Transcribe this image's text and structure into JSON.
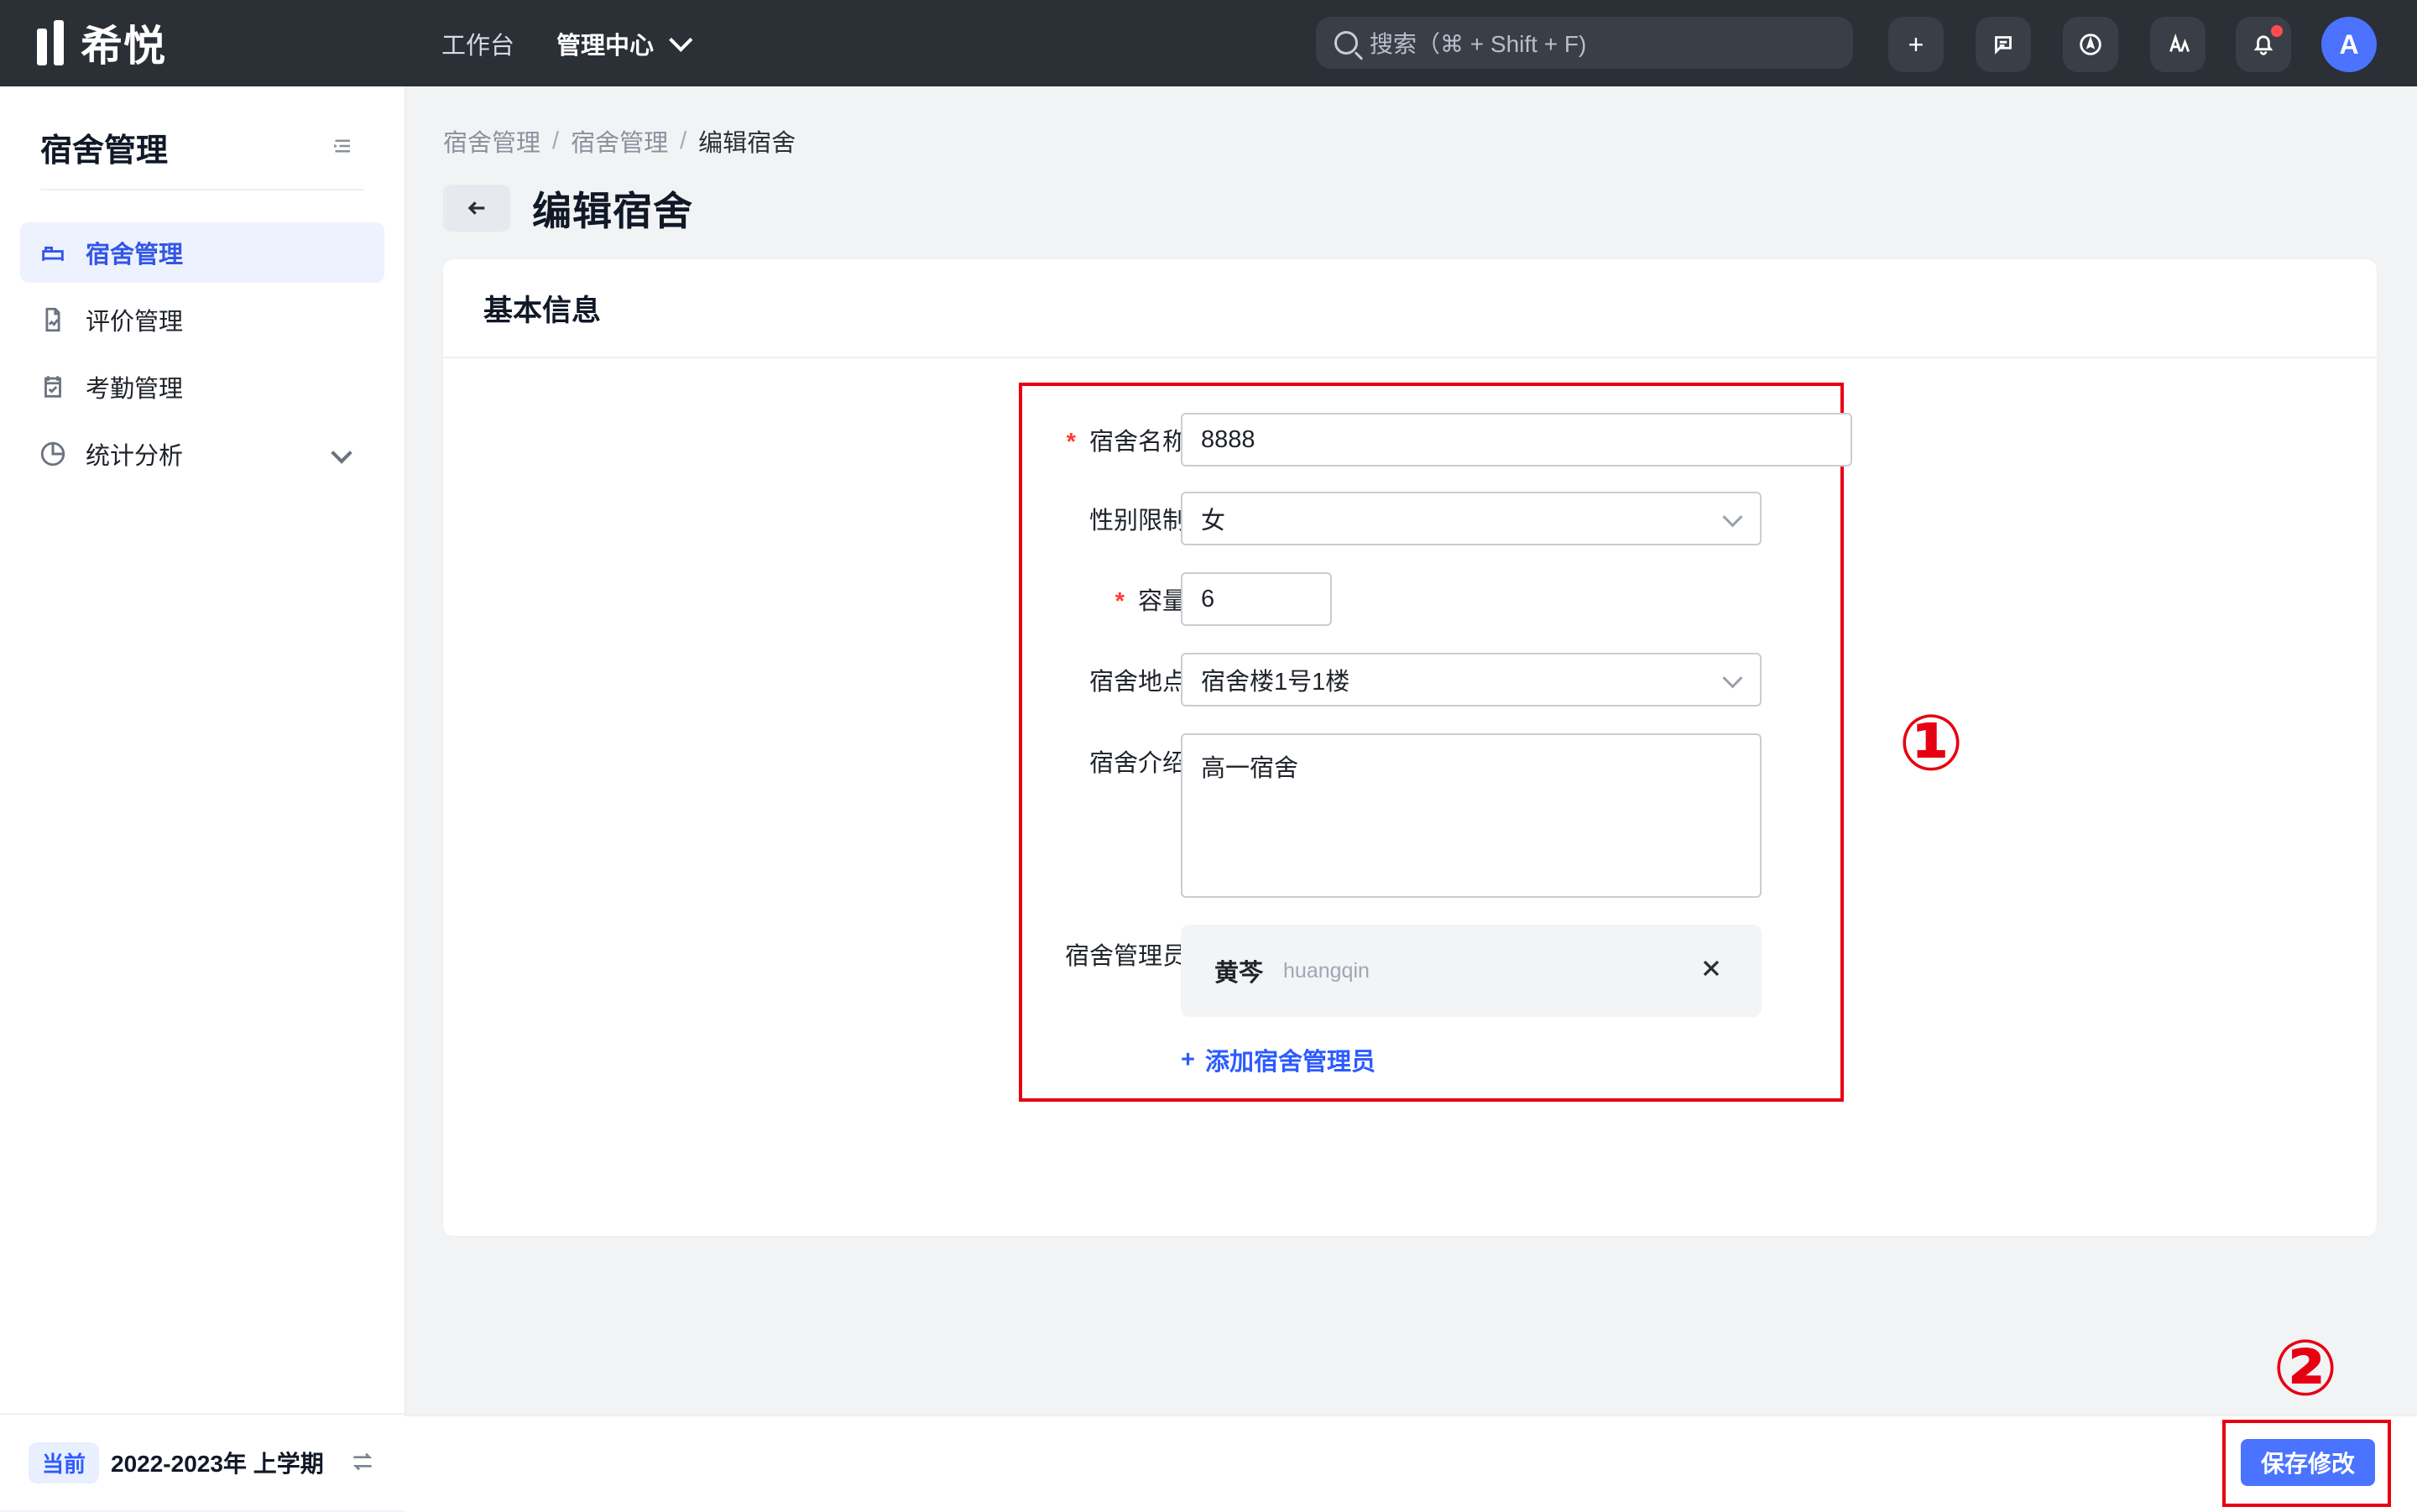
{
  "topbar": {
    "logo_text": "希悦",
    "nav": {
      "workbench": "工作台",
      "admin_center": "管理中心"
    },
    "search": {
      "placeholder": "搜索（⌘ + Shift + F)"
    },
    "avatar_letter": "A",
    "icons": [
      "plus-icon",
      "chat-icon",
      "compass-icon",
      "text-icon",
      "bell-icon"
    ]
  },
  "sidebar": {
    "title": "宿舍管理",
    "items": [
      {
        "label": "宿舍管理",
        "icon": "bed-icon",
        "active": true
      },
      {
        "label": "评价管理",
        "icon": "document-chart-icon",
        "active": false
      },
      {
        "label": "考勤管理",
        "icon": "calendar-check-icon",
        "active": false
      },
      {
        "label": "统计分析",
        "icon": "pie-chart-icon",
        "active": false,
        "has_children": true
      }
    ],
    "term": {
      "chip": "当前",
      "text": "2022-2023年 上学期"
    }
  },
  "page": {
    "breadcrumb": [
      "宿舍管理",
      "宿舍管理",
      "编辑宿舍"
    ],
    "title": "编辑宿舍",
    "card_title": "基本信息",
    "form": {
      "dorm_name_label": "宿舍名称",
      "dorm_name_value": "8888",
      "gender_label": "性别限制",
      "gender_value": "女",
      "capacity_label": "容量",
      "capacity_value": "6",
      "location_label": "宿舍地点",
      "location_value": "宿舍楼1号1楼",
      "intro_label": "宿舍介绍",
      "intro_value": "高一宿舍",
      "admin_label": "宿舍管理员",
      "admin_name": "黄芩",
      "admin_id": "huangqin",
      "add_admin": "添加宿舍管理员"
    },
    "save_button": "保存修改",
    "annotations": {
      "one": "①",
      "two": "②"
    }
  },
  "colors": {
    "topbar": "#2b2f36",
    "accent": "#3b64f6",
    "annotation": "#e60012"
  }
}
